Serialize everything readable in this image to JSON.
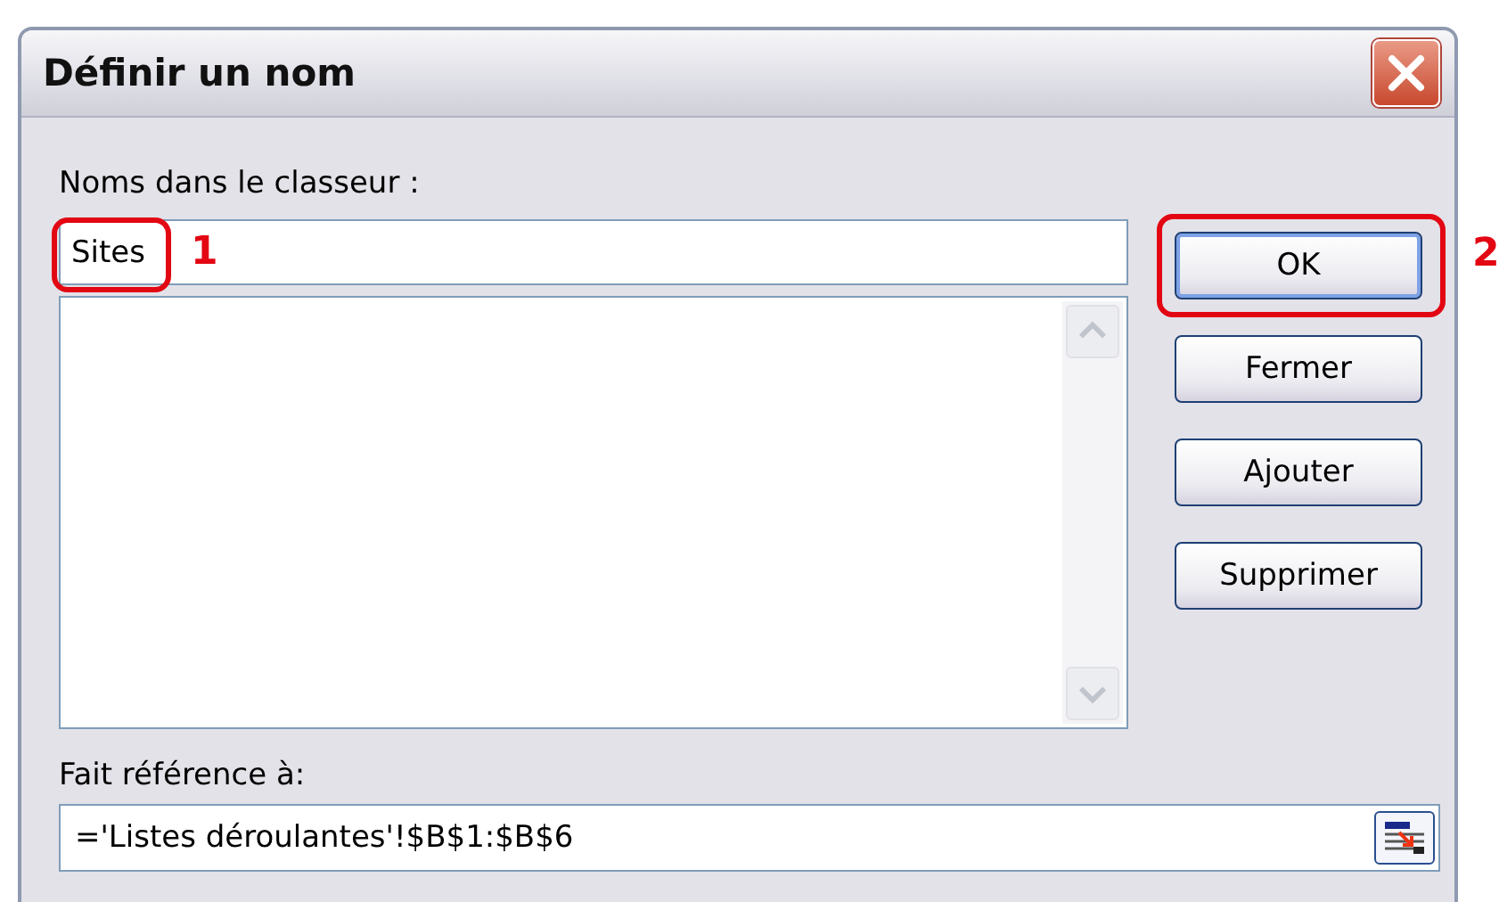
{
  "window": {
    "title": "Définir un nom"
  },
  "names_label": "Noms dans le classeur :",
  "name_field": {
    "value": "Sites"
  },
  "buttons": [
    {
      "label": "OK",
      "default": true
    },
    {
      "label": "Fermer",
      "default": false
    },
    {
      "label": "Ajouter",
      "default": false
    },
    {
      "label": "Supprimer",
      "default": false
    }
  ],
  "reference_label": "Fait référence à:",
  "reference_field": {
    "value": "='Listes déroulantes'!$B$1:$B$6"
  },
  "callouts": [
    {
      "label": "1"
    },
    {
      "label": "2"
    }
  ]
}
